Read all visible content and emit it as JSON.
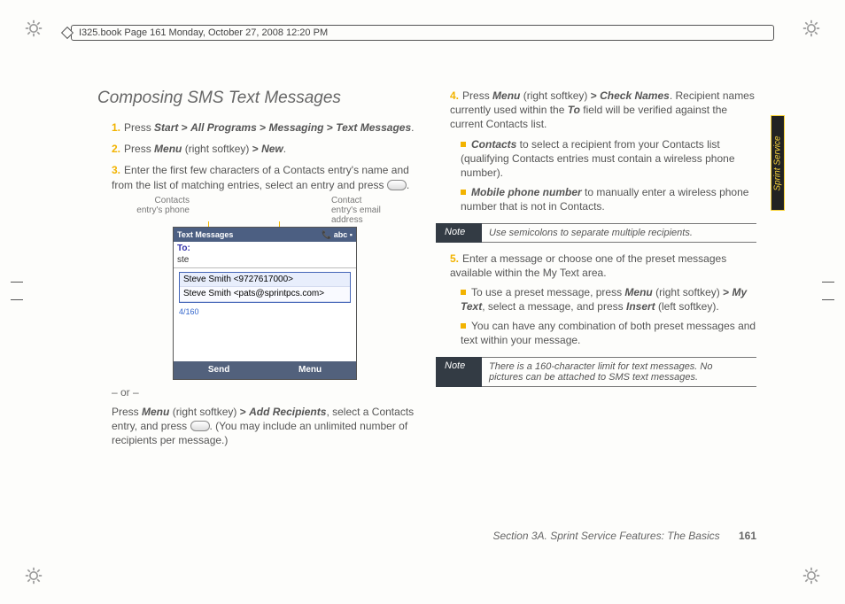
{
  "meta": {
    "header_line": "I325.book  Page 161  Monday, October 27, 2008  12:20 PM"
  },
  "side_tab": "Sprint Service",
  "heading": "Composing SMS Text Messages",
  "steps": {
    "s1_a": "Press ",
    "s1_b": "Start",
    "s1_c": "All Programs",
    "s1_d": "Messaging",
    "s1_e": "Text Messages",
    "s2_a": "Press ",
    "s2_b": "Menu",
    "s2_c": " (right softkey) ",
    "s2_d": "New",
    "s3": "Enter the first few characters of a Contacts entry's name and from the list of matching entries, select an entry and press ",
    "s3_alt_a": "Press ",
    "s3_alt_b": "Menu",
    "s3_alt_c": " (right softkey) ",
    "s3_alt_d": "Add Recipients",
    "s3_alt_e": ", select a Contacts entry, and press ",
    "s3_alt_f": ". (You may include an unlimited number of recipients per message.)",
    "or": "– or –",
    "s4_a": "Press ",
    "s4_b": "Menu",
    "s4_c": " (right softkey) ",
    "s4_d": "Check Names",
    "s4_e": ". Recipient names currently used within the ",
    "s4_f": "To",
    "s4_g": " field will be verified against the current Contacts list.",
    "s4_sub1_a": "Contacts",
    "s4_sub1_b": " to select a recipient from your Contacts list (qualifying Contacts entries must contain a wireless phone number).",
    "s4_sub2_a": "Mobile phone number",
    "s4_sub2_b": " to manually enter a wireless phone number that is not in Contacts.",
    "s5": "Enter a message or choose one of the preset messages available within the My Text area.",
    "s5_sub1_a": "To use a preset message, press ",
    "s5_sub1_b": "Menu",
    "s5_sub1_c": " (right softkey) ",
    "s5_sub1_d": "My Text",
    "s5_sub1_e": ", select a message, and press ",
    "s5_sub1_f": "Insert",
    "s5_sub1_g": " (left softkey).",
    "s5_sub2": "You can have any combination of both preset messages and text within your message."
  },
  "callouts": {
    "left_l1": "Contacts",
    "left_l2": "entry's phone",
    "right_l1": "Contact",
    "right_l2": "entry's email",
    "right_l3": "address"
  },
  "phone": {
    "title": "Text Messages",
    "signal": "📶",
    "abc": "abc",
    "to_label": "To:",
    "typed": "ste",
    "opt1": "Steve Smith  <9727617000>",
    "opt2": "Steve Smith  <pats@sprintpcs.com>",
    "count": "4/160",
    "soft_left": "Send",
    "soft_right": "Menu"
  },
  "notes": {
    "label": "Note",
    "n1": "Use semicolons to separate multiple recipients.",
    "n2": "There is a 160-character limit for text messages. No pictures can be attached to SMS text messages."
  },
  "footer": {
    "section": "Section 3A. Sprint Service Features: The Basics",
    "page": "161"
  }
}
